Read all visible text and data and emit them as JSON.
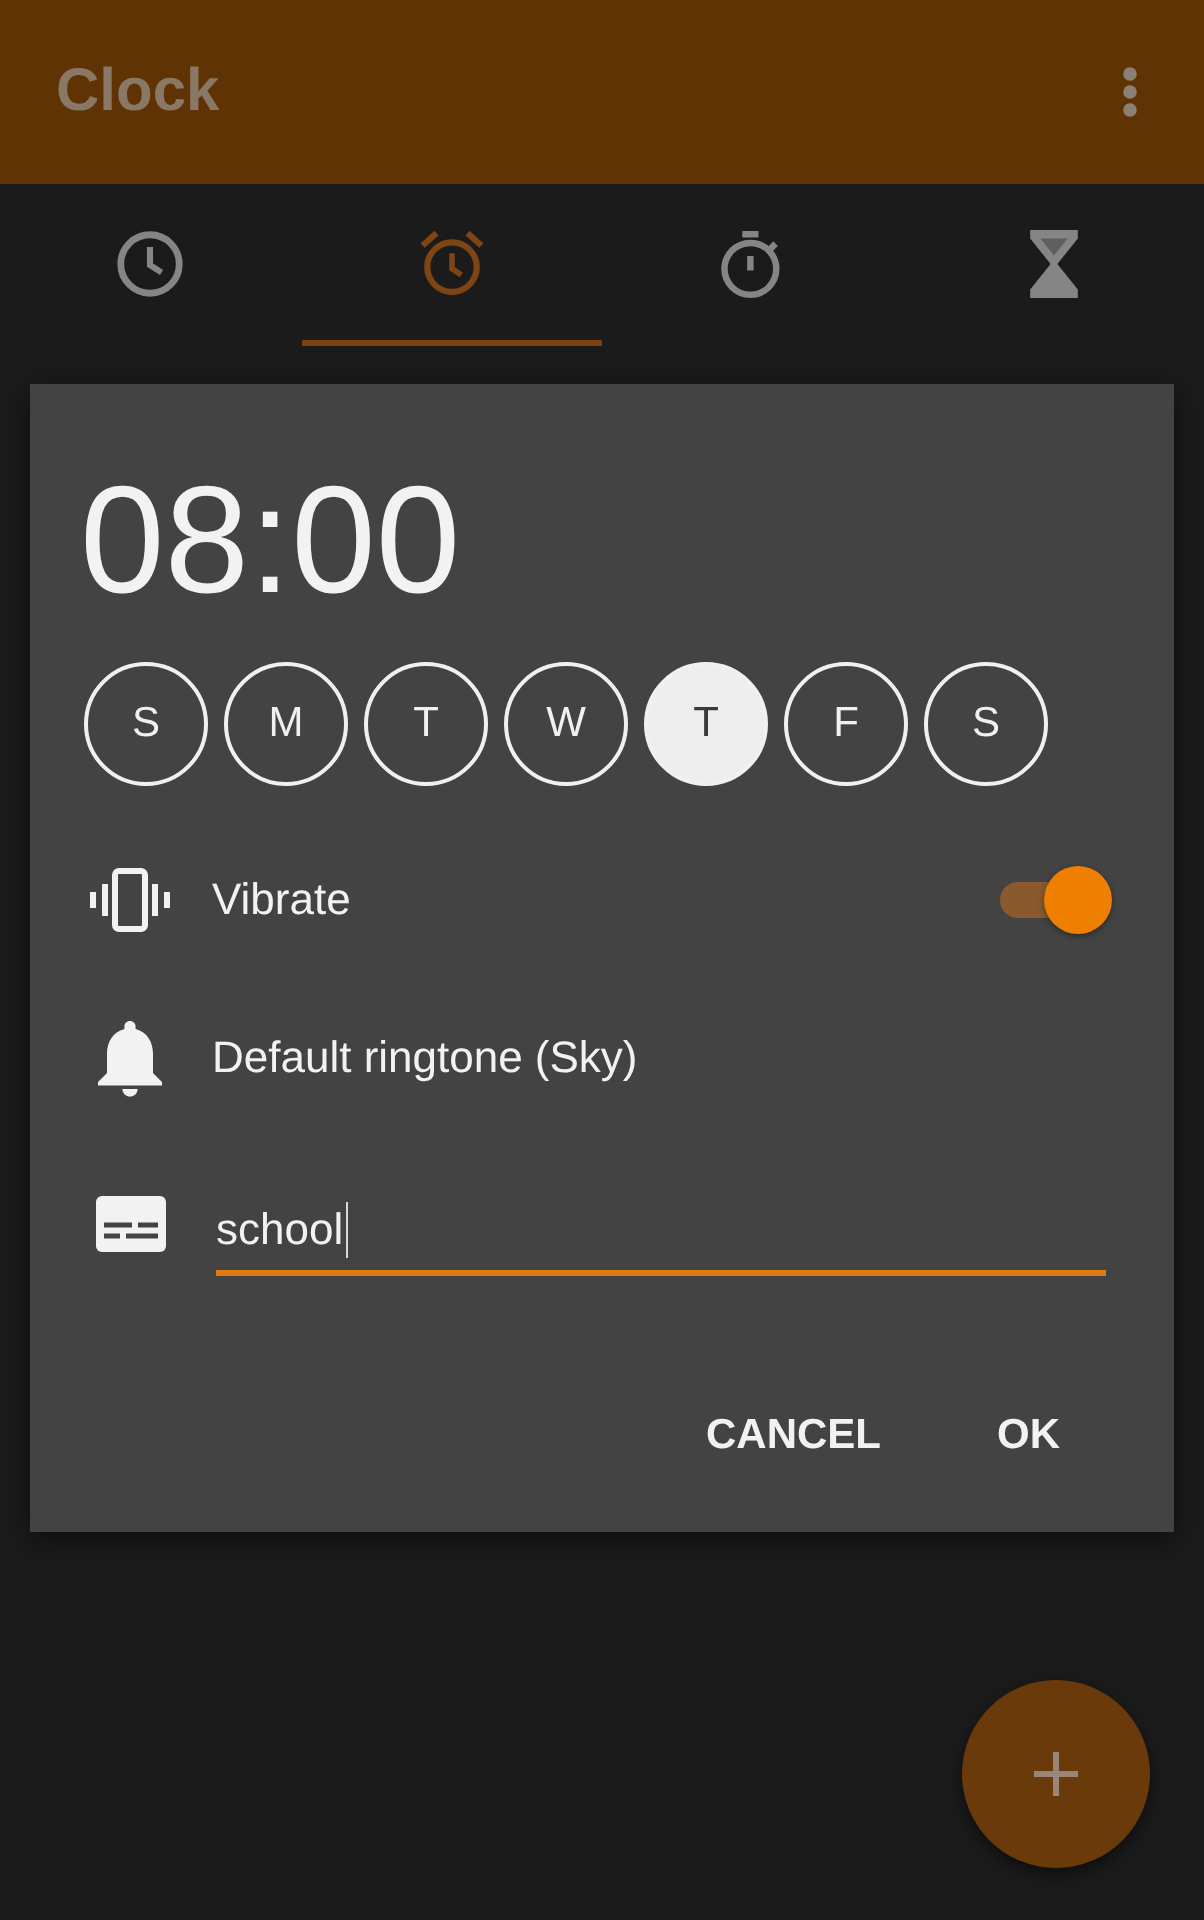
{
  "app_bar": {
    "title": "Clock"
  },
  "tabs": [
    {
      "kind": "clock",
      "selected": false
    },
    {
      "kind": "alarm",
      "selected": true
    },
    {
      "kind": "stopwatch",
      "selected": false
    },
    {
      "kind": "timer",
      "selected": false
    }
  ],
  "dialog": {
    "time": "08:00",
    "days": [
      {
        "label": "S",
        "selected": false
      },
      {
        "label": "M",
        "selected": false
      },
      {
        "label": "T",
        "selected": false
      },
      {
        "label": "W",
        "selected": false
      },
      {
        "label": "T",
        "selected": true
      },
      {
        "label": "F",
        "selected": false
      },
      {
        "label": "S",
        "selected": false
      }
    ],
    "vibrate": {
      "label": "Vibrate",
      "on": true
    },
    "ringtone": {
      "label": "Default ringtone (Sky)"
    },
    "label_field": {
      "value": "school",
      "focused": true
    },
    "buttons": [
      {
        "label": "CANCEL"
      },
      {
        "label": "OK"
      }
    ]
  }
}
